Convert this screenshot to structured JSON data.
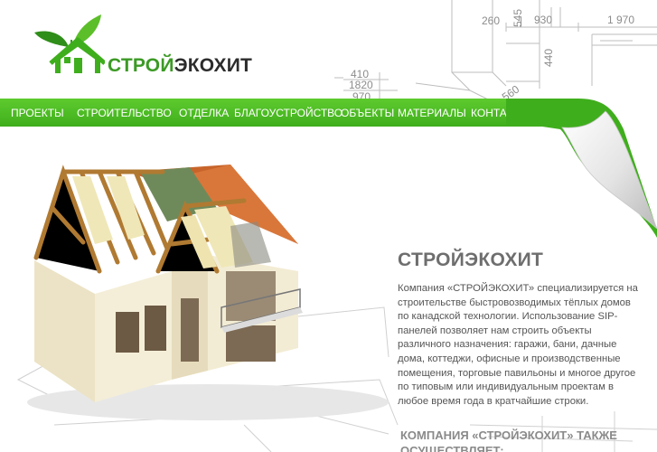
{
  "brand": {
    "name_part1": "СТРОЙ",
    "name_part2": "ЭКОХИТ",
    "primary_color": "#3fae1c",
    "leaf_color": "#5cbf2a"
  },
  "blueprint_labels": [
    "260",
    "930",
    "1 970",
    "545",
    "440",
    "410",
    "1820",
    "970",
    "560"
  ],
  "nav": {
    "items": [
      {
        "label": "ПРОЕКТЫ"
      },
      {
        "label": "СТРОИТЕЛЬСТВО"
      },
      {
        "label": "ОТДЕЛКА"
      },
      {
        "label": "БЛАГОУСТРОЙСТВО"
      },
      {
        "label": "ОБЪЕКТЫ"
      },
      {
        "label": "МАТЕРИАЛЫ"
      },
      {
        "label": "КОНТАКТЫ"
      }
    ]
  },
  "main": {
    "title": "СТРОЙЭКОХИТ",
    "body": "Компания «СТРОЙЭКОХИТ» специализируется на строительстве быстровозводимых тёплых домов по канадской технологии. Использование SIP-панелей позволяет нам строить объекты различного назначения: гаражи, бани, дачные дома, коттеджи, офисные и производственные помещения, торговые павильоны и многое другое по типовым или индивидуальным проектам в любое время года в кратчайшие строки.",
    "subtitle": "КОМПАНИЯ «СТРОЙЭКОХИТ» ТАКЖЕ ОСУЩЕСТВЛЯЕТ:"
  },
  "icons": {
    "logo": "leaf-house-icon",
    "illustration": "house-illustration"
  }
}
